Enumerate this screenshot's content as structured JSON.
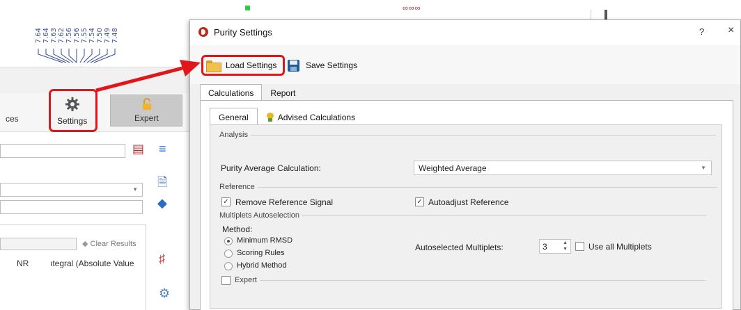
{
  "background_app": {
    "peak_labels": [
      "7.64",
      "7.64",
      "7.63",
      "7.62",
      "7.56",
      "7.56",
      "7.55",
      "7.54",
      "7.50",
      "7.49",
      "7.48"
    ],
    "ribbon_left_text": "ces",
    "settings_label": "Settings",
    "expert_label": "Expert",
    "clear_results_label": "Clear Results",
    "column_headers": [
      "NR",
      "ıtegral (Absolute Value"
    ]
  },
  "dialog": {
    "title": "Purity Settings",
    "help_symbol": "?",
    "close_symbol": "×",
    "toolbar": {
      "load_label": "Load Settings",
      "save_label": "Save Settings"
    },
    "outer_tabs": [
      "Calculations",
      "Report"
    ],
    "inner_tabs": [
      "General",
      "Advised Calculations"
    ],
    "analysis": {
      "group_label": "Analysis",
      "purity_label": "Purity Average Calculation:",
      "purity_value": "Weighted Average"
    },
    "reference": {
      "group_label": "Reference",
      "remove_signal_label": "Remove Reference Signal",
      "remove_signal_checked": true,
      "autoadjust_label": "Autoadjust Reference",
      "autoadjust_checked": true
    },
    "multiplets": {
      "group_label": "Multiplets Autoselection",
      "method_label": "Method:",
      "methods": [
        "Minimum RMSD",
        "Scoring Rules",
        "Hybrid Method"
      ],
      "selected_method": "Minimum RMSD",
      "autoselected_label": "Autoselected Multiplets:",
      "autoselected_value": "3",
      "use_all_label": "Use all Multiplets",
      "use_all_checked": false
    },
    "expert": {
      "group_label": "Expert",
      "checked": false
    }
  },
  "colors": {
    "highlight_red": "#e0161b",
    "dialog_bg": "#f0f0f0"
  }
}
